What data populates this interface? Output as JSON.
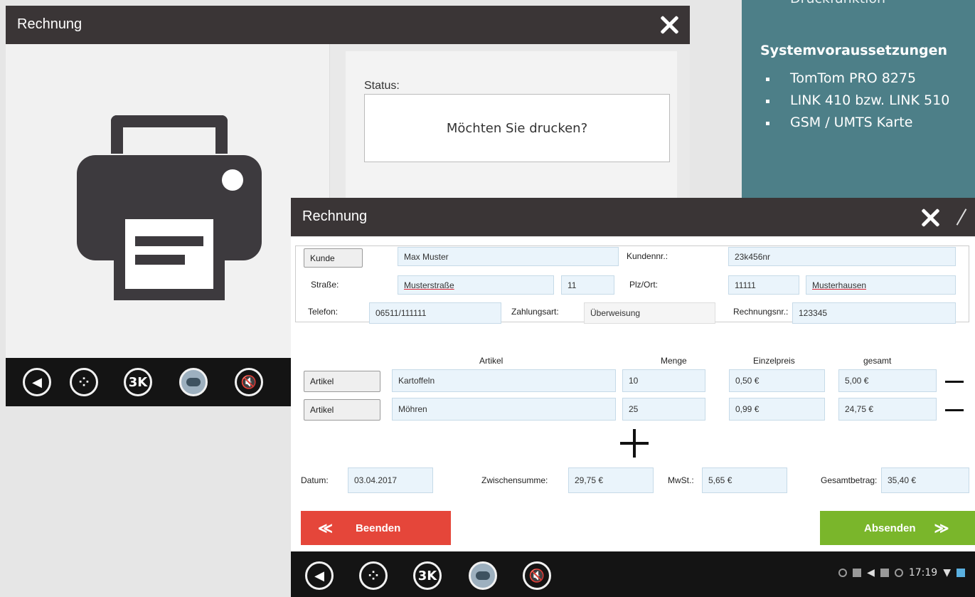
{
  "info_panel": {
    "top_item": "Druckfunktion",
    "heading": "Systemvoraussetzungen",
    "items": [
      "TomTom PRO 8275",
      "LINK 410 bzw. LINK 510",
      "GSM / UMTS Karte"
    ]
  },
  "back_screen": {
    "title": "Rechnung",
    "status_label": "Status:",
    "status_message": "Möchten Sie drucken?",
    "nav": [
      "back",
      "apps",
      "3K",
      "gps",
      "mute"
    ]
  },
  "front_screen": {
    "title": "Rechnung",
    "customer": {
      "kunde_button": "Kunde",
      "name": "Max Muster",
      "kundennr_label": "Kundennr.:",
      "kundennr": "23k456nr",
      "strasse_label": "Straße:",
      "strasse": "Musterstraße",
      "hausnr": "11",
      "plzort_label": "Plz/Ort:",
      "plz": "11111",
      "ort": "Musterhausen",
      "telefon_label": "Telefon:",
      "telefon": "06511/111111",
      "zahlungsart_label": "Zahlungsart:",
      "zahlungsart": "Überweisung",
      "rechnungsnr_label": "Rechnungsnr.:",
      "rechnungsnr": "123345"
    },
    "items_header": {
      "artikel": "Artikel",
      "menge": "Menge",
      "einzelpreis": "Einzelpreis",
      "gesamt": "gesamt"
    },
    "items": [
      {
        "button": "Artikel",
        "name": "Kartoffeln",
        "menge": "10",
        "einzelpreis": "0,50 €",
        "gesamt": "5,00 €"
      },
      {
        "button": "Artikel",
        "name": "Möhren",
        "menge": "25",
        "einzelpreis": "0,99 €",
        "gesamt": "24,75 €"
      }
    ],
    "totals": {
      "datum_label": "Datum:",
      "datum": "03.04.2017",
      "zwischensumme_label": "Zwischensumme:",
      "zwischensumme": "29,75 €",
      "mwst_label": "MwSt.:",
      "mwst": "5,65 €",
      "gesamtbetrag_label": "Gesamtbetrag:",
      "gesamtbetrag": "35,40 €"
    },
    "buttons": {
      "beenden": "Beenden",
      "absenden": "Absenden",
      "beenden_arrows": "≪",
      "absenden_arrows": "≫"
    },
    "statusbar": {
      "time": "17:19"
    },
    "nav": [
      "back",
      "apps",
      "3K",
      "gps",
      "mute"
    ]
  },
  "colors": {
    "title_bar": "#3a3536",
    "nav_bar": "#141414",
    "info_panel": "#4d7f88",
    "beenden": "#e5463a",
    "absenden": "#7ab62b",
    "field": "#eaf4fb"
  }
}
